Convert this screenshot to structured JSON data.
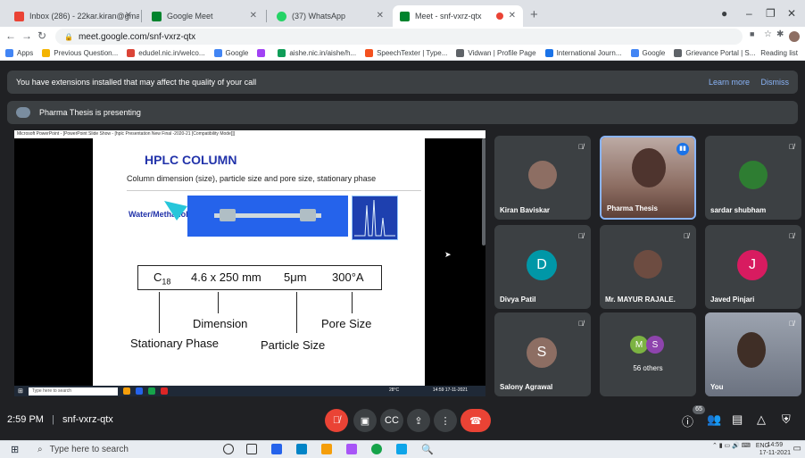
{
  "browser": {
    "tabs": [
      {
        "label": "Inbox (286) - 22kar.kiran@gmail",
        "icon": "gmail-icon",
        "color": "#ea4335"
      },
      {
        "label": "Google Meet",
        "icon": "meet-icon",
        "color": "#00832d"
      },
      {
        "label": "(37) WhatsApp",
        "icon": "whatsapp-icon",
        "color": "#25d366"
      },
      {
        "label": "Meet - snf-vxrz-qtx",
        "icon": "meet-icon",
        "color": "#00832d"
      }
    ],
    "new_tab": "+",
    "url": "meet.google.com/snf-vxrz-qtx",
    "bookmarks": [
      {
        "label": "Apps",
        "color": "#4285f4"
      },
      {
        "label": "Previous Question...",
        "color": "#f4b400"
      },
      {
        "label": "edudel.nic.in/welco...",
        "color": "#db4437"
      },
      {
        "label": "Google",
        "color": "#4285f4"
      },
      {
        "label": "",
        "color": "#a142f4"
      },
      {
        "label": "aishe.nic.in/aishe/h...",
        "color": "#0f9d58"
      },
      {
        "label": "SpeechTexter | Type...",
        "color": "#f4511e"
      },
      {
        "label": "Vidwan | Profile Page",
        "color": "#5f6368"
      },
      {
        "label": "International Journ...",
        "color": "#1a73e8"
      },
      {
        "label": "Google",
        "color": "#4285f4"
      },
      {
        "label": "Grievance Portal | S...",
        "color": "#5f6368"
      }
    ],
    "reading_list": "Reading list"
  },
  "meet": {
    "ext_banner": "You have extensions installed that may affect the quality of your call",
    "learn_more": "Learn more",
    "dismiss": "Dismiss",
    "presenting": "Pharma Thesis is presenting",
    "ppt_title": "Microsoft PowerPoint - [PowerPoint Slide Show - [hplc Presentation New Final -2020-21 [Compatibility Mode]]]",
    "slide": {
      "title": "HPLC COLUMN",
      "subtitle": "Column dimension (size), particle size and pore size, stationary phase",
      "water_label": "Water/Methanol",
      "spec_c": "C18",
      "spec_dims": "4.6 x 250 mm",
      "spec_particle": "5μm",
      "spec_pore": "300°A",
      "label_dimension": "Dimension",
      "label_pore": "Pore Size",
      "label_stationary": "Stationary Phase",
      "label_particle": "Particle Size"
    },
    "inner_taskbar": {
      "search": "Type here to search",
      "weather": "28°C",
      "clock": "14:59 17-11-2021"
    },
    "participants": [
      {
        "name": "Kiran Baviskar",
        "kind": "photo",
        "color": "#8d6e63"
      },
      {
        "name": "Pharma Thesis",
        "kind": "video",
        "color": "#a1887f"
      },
      {
        "name": "sardar shubham",
        "kind": "photo",
        "color": "#2e7d32"
      },
      {
        "name": "Divya Patil",
        "kind": "letter",
        "letter": "D",
        "color": "#0097a7"
      },
      {
        "name": "Mr. MAYUR RAJALE.",
        "kind": "photo",
        "color": "#6d4c41"
      },
      {
        "name": "Javed Pinjari",
        "kind": "letter",
        "letter": "J",
        "color": "#d81b60"
      },
      {
        "name": "Salony Agrawal",
        "kind": "letter",
        "letter": "S",
        "color": "#8d6e63"
      },
      {
        "name": "56 others",
        "kind": "others",
        "letters": [
          "M",
          "S"
        ]
      },
      {
        "name": "You",
        "kind": "video",
        "color": "#6b7280"
      }
    ],
    "time": "2:59 PM",
    "meeting_code": "snf-vxrz-qtx",
    "participant_count": "65"
  },
  "taskbar": {
    "search": "Type here to search",
    "lang": "ENG",
    "time": "14:59",
    "date": "17-11-2021"
  }
}
